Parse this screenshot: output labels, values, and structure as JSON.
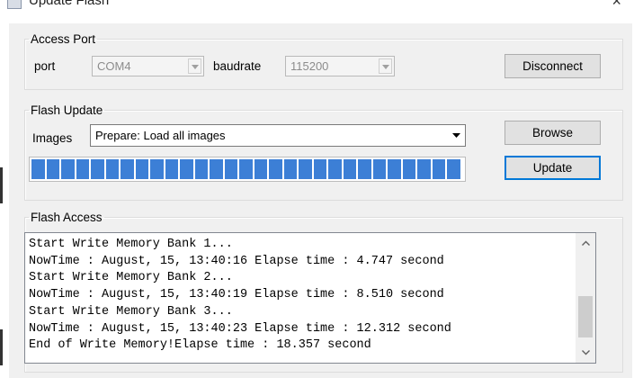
{
  "window": {
    "title": "Update Flash"
  },
  "access_port": {
    "legend": "Access Port",
    "port_label": "port",
    "port_value": "COM4",
    "baudrate_label": "baudrate",
    "baudrate_value": "115200",
    "disconnect_label": "Disconnect"
  },
  "flash_update": {
    "legend": "Flash Update",
    "images_label": "Images",
    "images_value": "Prepare: Load all images",
    "browse_label": "Browse",
    "update_label": "Update",
    "progress_fraction": 1.0,
    "progress_color": "#3c7fd6"
  },
  "flash_access": {
    "legend": "Flash Access",
    "log_lines": [
      "Start Write Memory Bank 1...",
      "NowTime : August, 15, 13:40:16 Elapse time : 4.747 second",
      "Start Write Memory Bank 2...",
      "NowTime : August, 15, 13:40:19 Elapse time : 8.510 second",
      "Start Write Memory Bank 3...",
      "NowTime : August, 15, 13:40:23 Elapse time : 12.312 second",
      "End of Write Memory!Elapse time : 18.357 second"
    ]
  },
  "icons": {
    "close": "close-icon",
    "dropdown": "chevron-down-icon",
    "scroll_up": "chevron-up-icon",
    "scroll_down": "chevron-down-icon"
  }
}
